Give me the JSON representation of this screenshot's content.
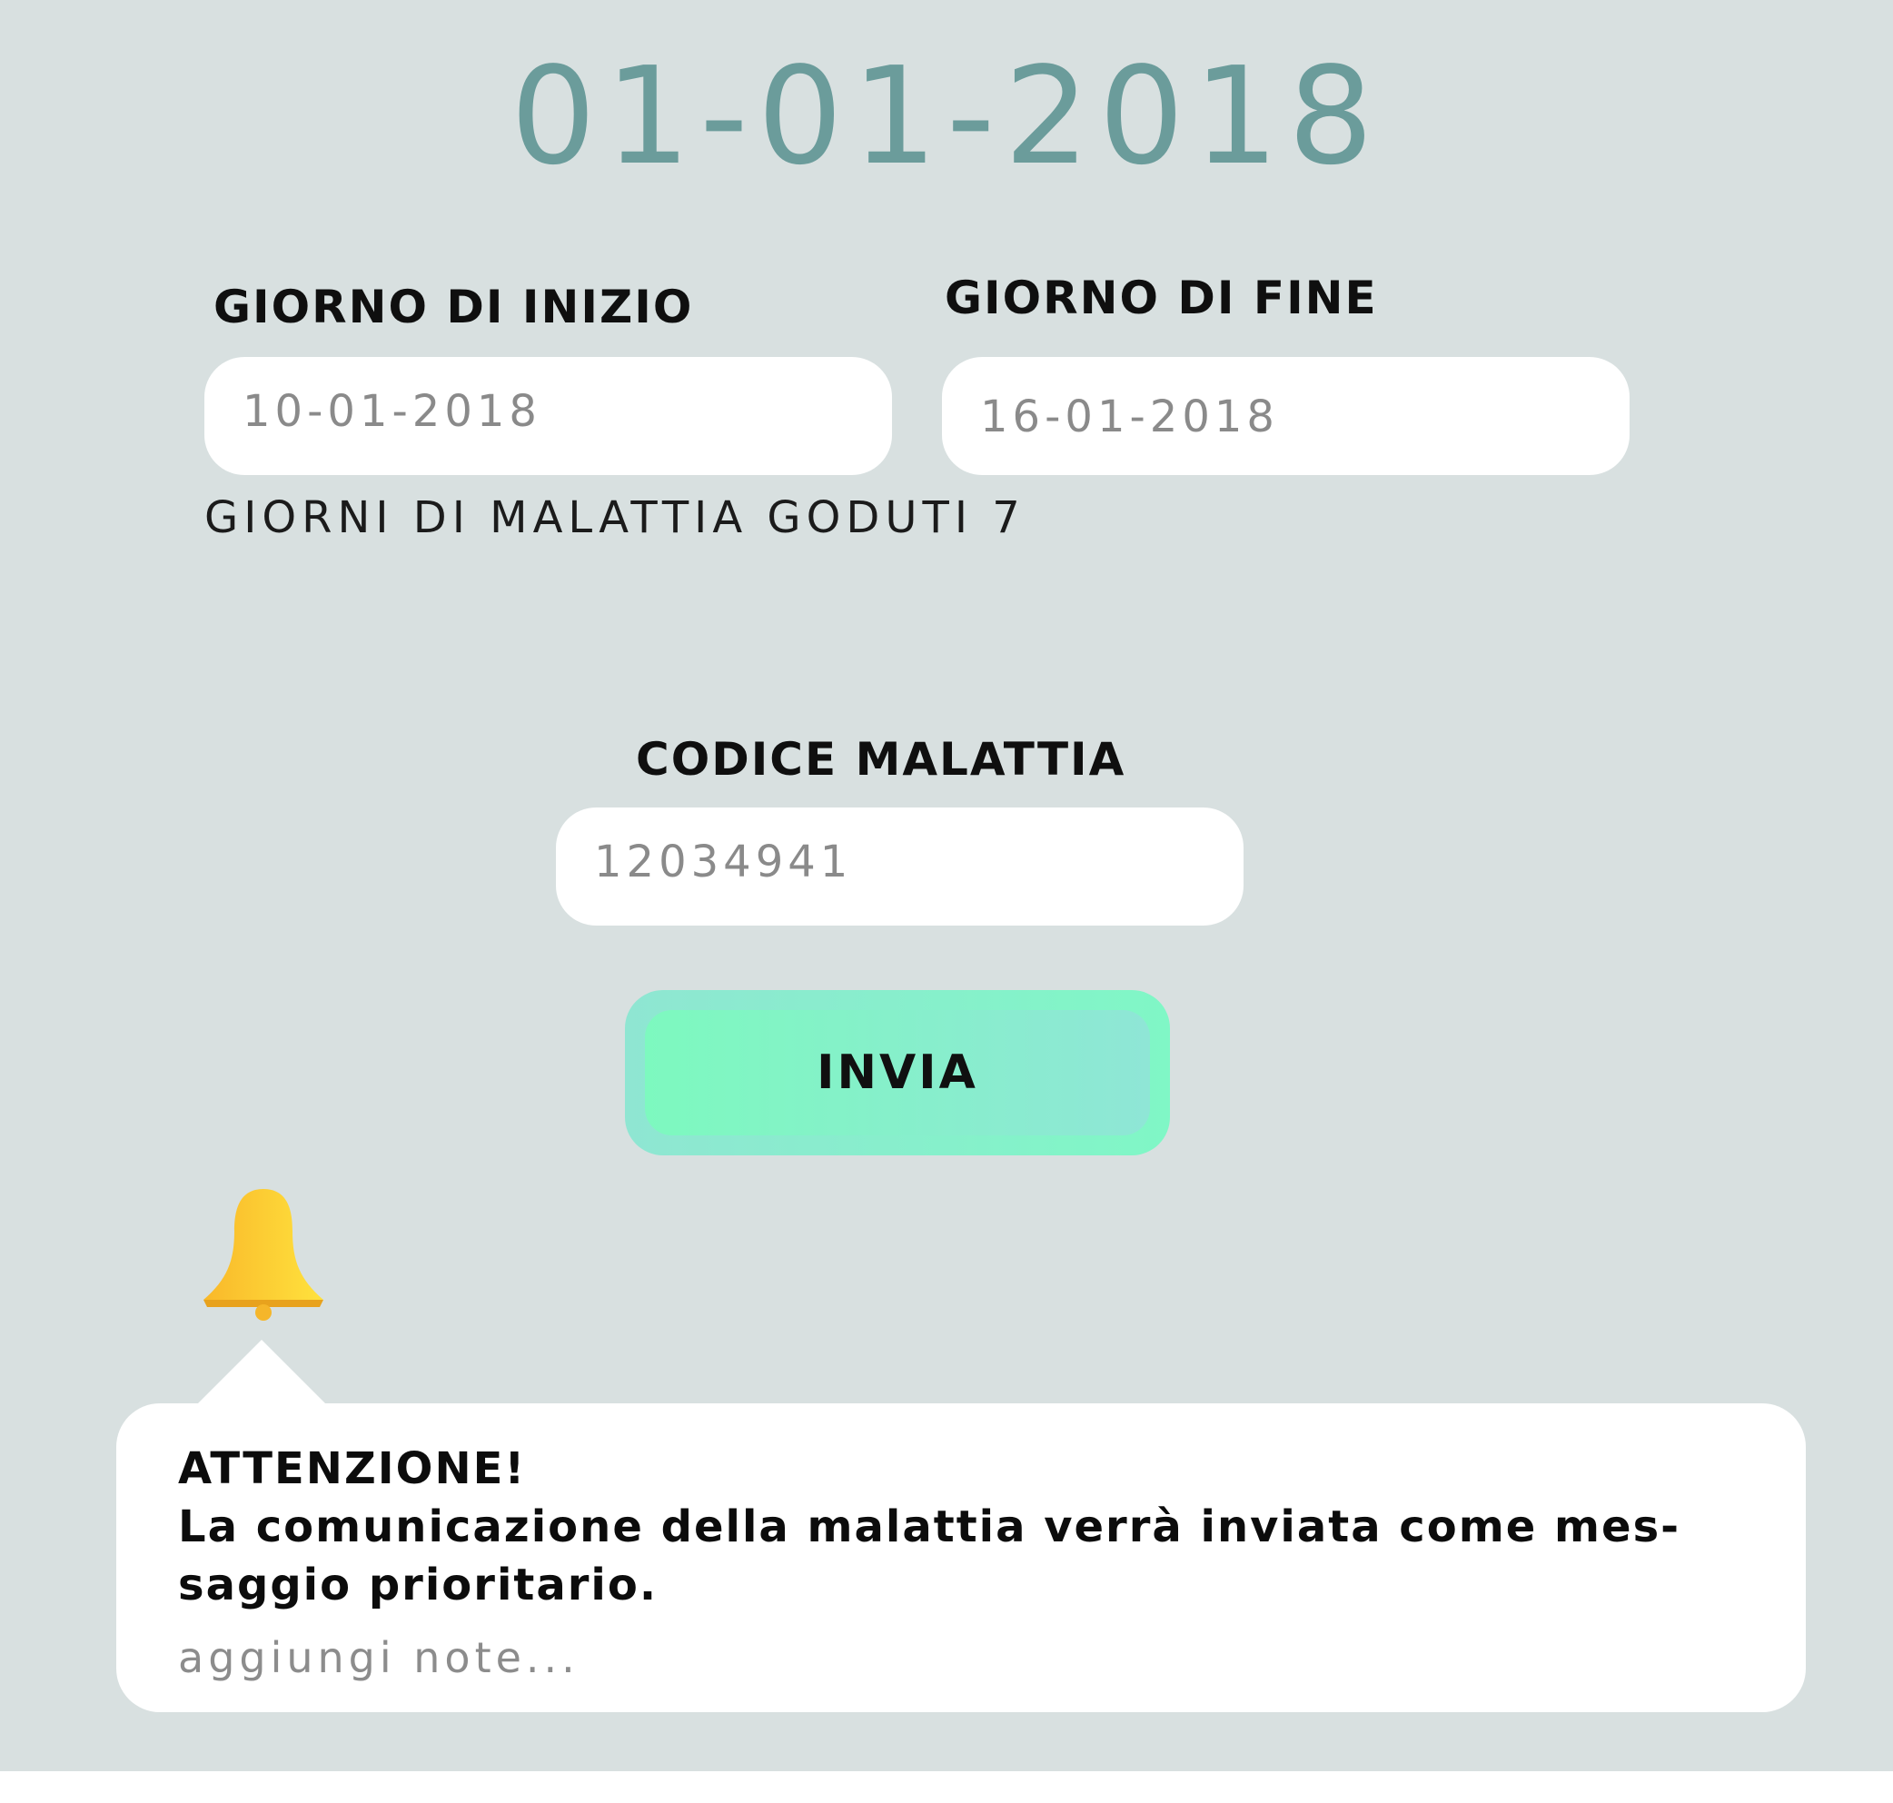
{
  "header": {
    "date": "01-01-2018"
  },
  "form": {
    "start_label": "GIORNO DI INIZIO",
    "start_value": "10-01-2018",
    "end_label": "GIORNO DI FINE",
    "end_value": "16-01-2018",
    "sick_days_text": "GIORNI DI MALATTIA GODUTI 7",
    "code_label": "CODICE MALATTIA",
    "code_value": "12034941",
    "submit_label": "INVIA"
  },
  "notice": {
    "icon": "bell-icon",
    "title": "ATTENZIONE!",
    "message_line1": "La comunicazione della malattia verrà inviata come mes-",
    "message_line2": "saggio prioritario.",
    "notes_placeholder": "aggiungi note..."
  },
  "colors": {
    "background": "#d8e0e0",
    "date_title": "#6b9c9b",
    "button_gradient_start": "#7df9bf",
    "button_gradient_end": "#8fe6d6",
    "bell": "#ffd23c"
  }
}
